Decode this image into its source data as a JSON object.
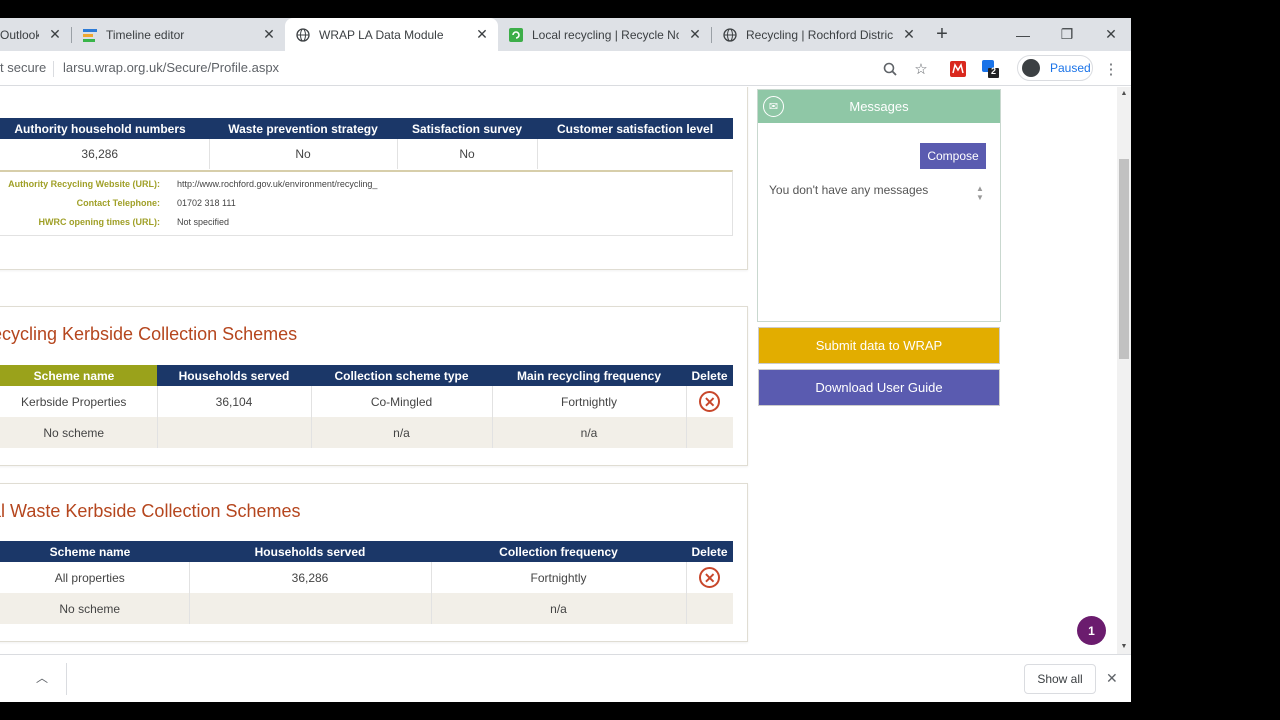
{
  "browser": {
    "tabs": [
      {
        "title": "Outlook",
        "icon": "mail-icon"
      },
      {
        "title": "Timeline editor",
        "icon": "timeline-icon"
      },
      {
        "title": "WRAP LA Data Module",
        "icon": "globe-icon",
        "active": true
      },
      {
        "title": "Local recycling | Recycle Now",
        "icon": "recycle-now-icon"
      },
      {
        "title": "Recycling | Rochford District C",
        "icon": "globe-icon"
      }
    ],
    "security_label": "t secure",
    "url": "larsu.wrap.org.uk/Secure/Profile.aspx",
    "profile_status": "Paused",
    "extension_badge": "2"
  },
  "authority": {
    "headers": [
      "Authority household numbers",
      "Waste prevention strategy",
      "Satisfaction survey",
      "Customer satisfaction level"
    ],
    "row": [
      "36,286",
      "No",
      "No",
      ""
    ],
    "info": [
      {
        "label": "Authority Recycling Website (URL):",
        "value": "http://www.rochford.gov.uk/environment/recycling_"
      },
      {
        "label": "Contact Telephone:",
        "value": "01702 318 111"
      },
      {
        "label": "HWRC opening times (URL):",
        "value": "Not specified"
      }
    ]
  },
  "recycling": {
    "title": "Recycling Kerbside Collection Schemes",
    "headers": [
      "Scheme name",
      "Households served",
      "Collection scheme type",
      "Main recycling frequency",
      "Delete"
    ],
    "rows": [
      [
        "Kerbside Properties",
        "36,104",
        "Co-Mingled",
        "Fortnightly"
      ],
      [
        "No scheme",
        "",
        "n/a",
        "n/a"
      ]
    ]
  },
  "residual": {
    "title": "Residual Waste Kerbside Collection Schemes",
    "headers": [
      "Scheme name",
      "Households served",
      "Collection frequency",
      "Delete"
    ],
    "rows": [
      [
        "All properties",
        "36,286",
        "Fortnightly"
      ],
      [
        "No scheme",
        "",
        "n/a"
      ]
    ]
  },
  "messages": {
    "title": "Messages",
    "compose": "Compose",
    "empty": "You don't have any messages"
  },
  "actions": {
    "submit": "Submit data to WRAP",
    "guide": "Download User Guide"
  },
  "notification_count": "1",
  "downloads": {
    "show_all": "Show all"
  },
  "colors": {
    "table_header": "#1b3768",
    "section_title": "#b5461e",
    "submit": "#e2ad00",
    "guide": "#5a5bb0",
    "messages_header": "#8fc7a6",
    "scheme_name_header": "#9aa21b"
  }
}
